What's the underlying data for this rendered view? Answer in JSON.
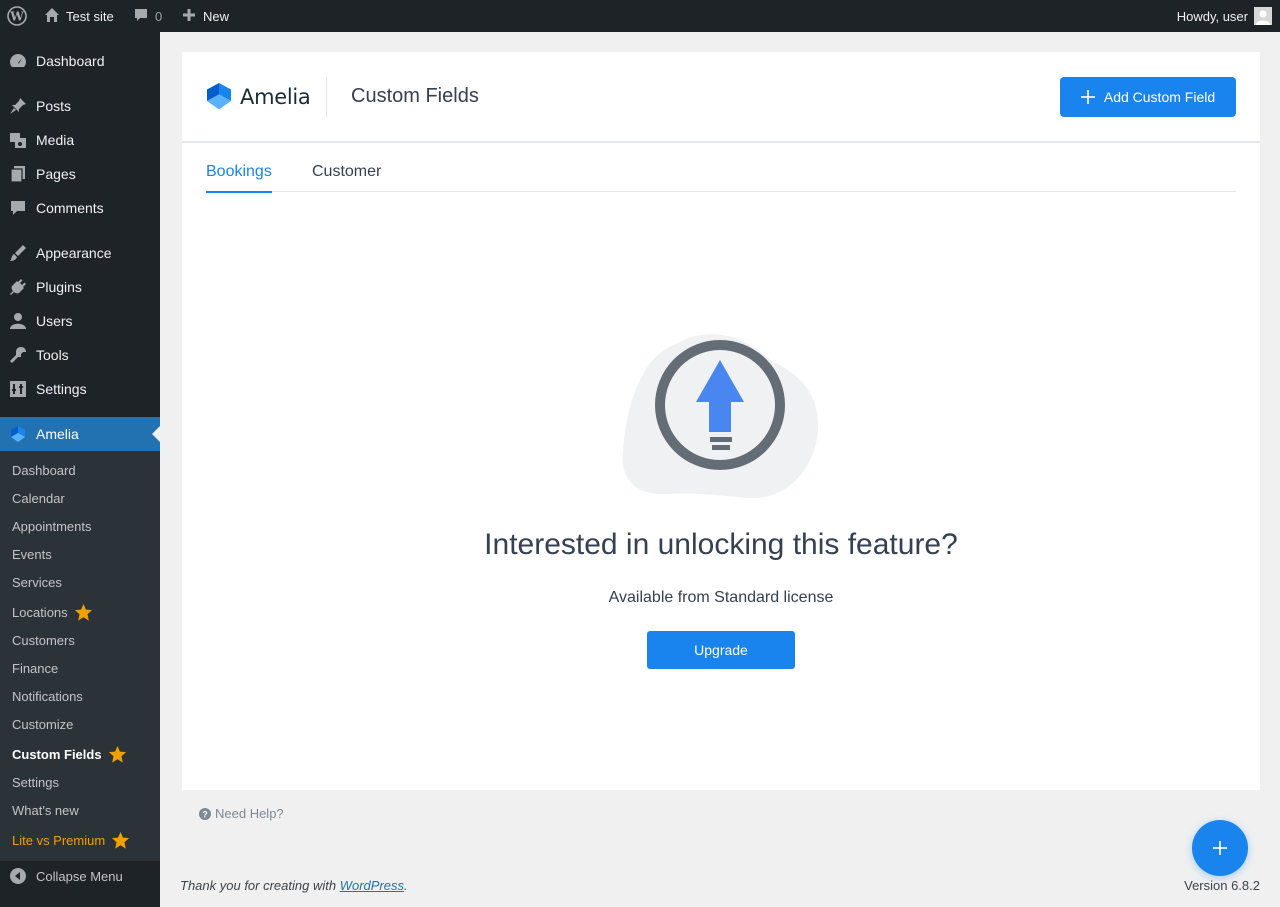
{
  "adminbar": {
    "site_name": "Test site",
    "comments_count": "0",
    "new_label": "New",
    "howdy": "Howdy, user"
  },
  "sidebar": {
    "items": [
      {
        "label": "Dashboard",
        "icon": "dashboard-icon"
      },
      {
        "label": "Posts",
        "icon": "pin-icon"
      },
      {
        "label": "Media",
        "icon": "media-icon"
      },
      {
        "label": "Pages",
        "icon": "pages-icon"
      },
      {
        "label": "Comments",
        "icon": "comment-icon"
      },
      {
        "label": "Appearance",
        "icon": "brush-icon"
      },
      {
        "label": "Plugins",
        "icon": "plugin-icon"
      },
      {
        "label": "Users",
        "icon": "user-icon"
      },
      {
        "label": "Tools",
        "icon": "wrench-icon"
      },
      {
        "label": "Settings",
        "icon": "settings-icon"
      },
      {
        "label": "Amelia",
        "icon": "amelia-icon"
      }
    ],
    "submenu": [
      {
        "label": "Dashboard"
      },
      {
        "label": "Calendar"
      },
      {
        "label": "Appointments"
      },
      {
        "label": "Events"
      },
      {
        "label": "Services"
      },
      {
        "label": "Locations"
      },
      {
        "label": "Customers"
      },
      {
        "label": "Finance"
      },
      {
        "label": "Notifications"
      },
      {
        "label": "Customize"
      },
      {
        "label": "Custom Fields"
      },
      {
        "label": "Settings"
      },
      {
        "label": "What's new"
      },
      {
        "label": "Lite vs Premium"
      }
    ],
    "collapse_label": "Collapse Menu"
  },
  "header": {
    "logo_text": "Amelia",
    "title": "Custom Fields",
    "add_button": "Add Custom Field"
  },
  "tabs": [
    {
      "label": "Bookings",
      "active": true
    },
    {
      "label": "Customer",
      "active": false
    }
  ],
  "upsell": {
    "title": "Interested in unlocking this feature?",
    "subtitle": "Available from Standard license",
    "button": "Upgrade"
  },
  "need_help": "Need Help?",
  "footer": {
    "thanks_prefix": "Thank you for creating with ",
    "link": "WordPress",
    "suffix": ".",
    "version": "Version 6.8.2"
  },
  "colors": {
    "accent": "#1a84ee",
    "wp_blue": "#2271b1",
    "sidebar_bg": "#1d2327",
    "premium_orange": "#f0a000"
  }
}
